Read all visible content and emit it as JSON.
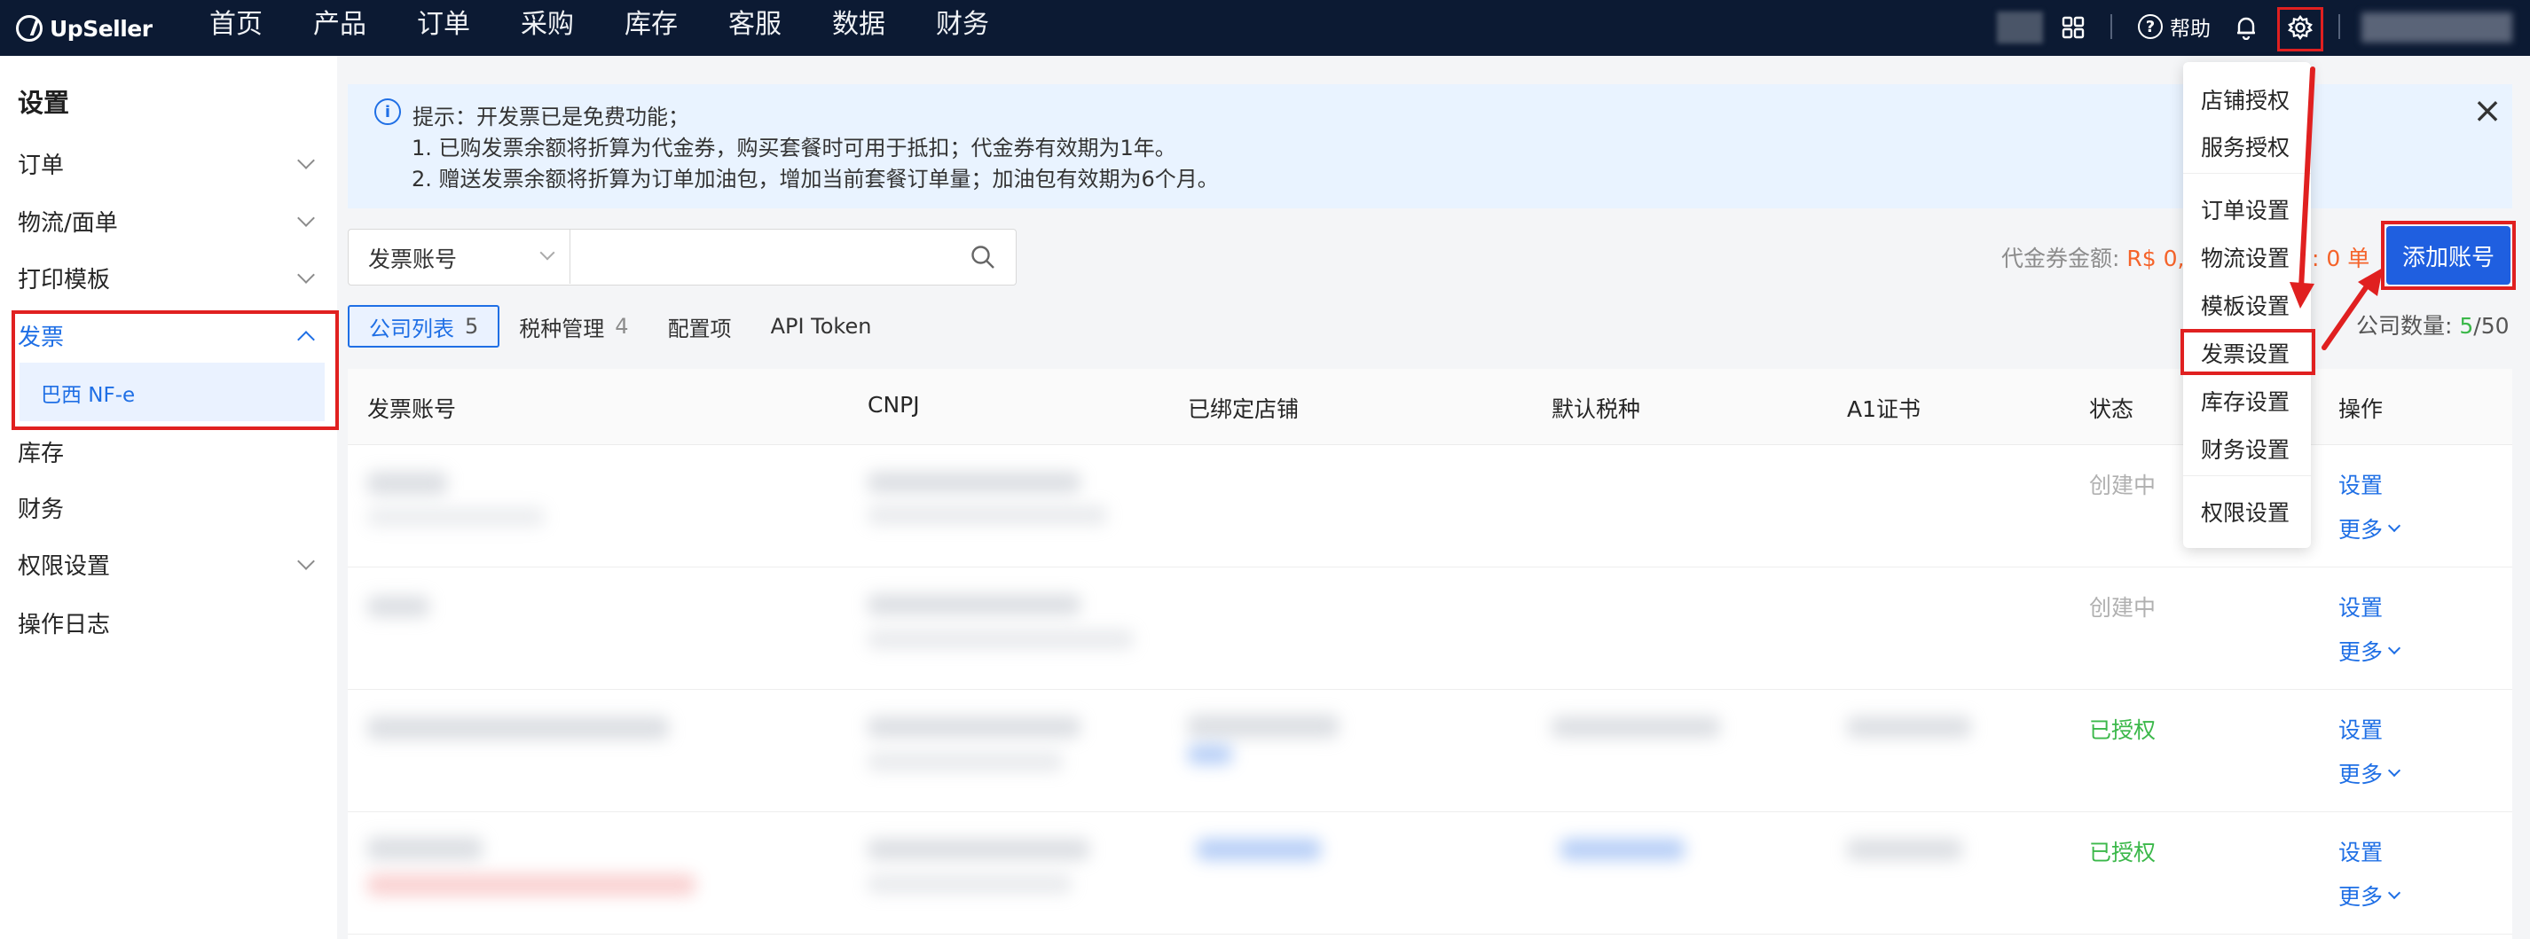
{
  "app": {
    "logo_text": "UpSeller"
  },
  "nav": {
    "items": [
      "首页",
      "产品",
      "订单",
      "采购",
      "库存",
      "客服",
      "数据",
      "财务"
    ]
  },
  "topbar": {
    "help_label": "帮助"
  },
  "sidebar": {
    "title": "设置",
    "items": [
      {
        "label": "订单"
      },
      {
        "label": "物流/面单"
      },
      {
        "label": "打印模板"
      },
      {
        "label": "发票"
      },
      {
        "label": "库存"
      },
      {
        "label": "财务"
      },
      {
        "label": "权限设置"
      },
      {
        "label": "操作日志"
      }
    ],
    "sub_item": "巴西 NF-e"
  },
  "notice": {
    "line1": "提示：开发票已是免费功能；",
    "line2": "1. 已购发票余额将折算为代金券，购买套餐时可用于抵扣；代金券有效期为1年。",
    "line3": "2. 赠送发票余额将折算为订单加油包，增加当前套餐订单量；加油包有效期为6个月。"
  },
  "search": {
    "select_value": "发票账号",
    "placeholder": ""
  },
  "voucher": {
    "label": "代金券金额: ",
    "value": "R$ 0,0",
    "tail": ": 0 单"
  },
  "add_button": "添加账号",
  "tabs": [
    {
      "label": "公司列表",
      "count": "5"
    },
    {
      "label": "税种管理",
      "count": "4"
    },
    {
      "label": "配置项",
      "count": ""
    },
    {
      "label": "API Token",
      "count": ""
    }
  ],
  "company_count": {
    "label": "公司数量: ",
    "current": "5",
    "total": "/50"
  },
  "table": {
    "headers": [
      "发票账号",
      "CNPJ",
      "已绑定店铺",
      "默认税种",
      "A1证书",
      "状态",
      "操作"
    ],
    "rows": [
      {
        "status": "创建中",
        "set": "设置",
        "more": "更多"
      },
      {
        "status": "创建中",
        "set": "设置",
        "more": "更多"
      },
      {
        "status": "已授权",
        "set": "设置",
        "more": "更多"
      },
      {
        "status": "已授权",
        "set": "设置",
        "more": "更多"
      }
    ]
  },
  "dropdown": {
    "items": [
      "店铺授权",
      "服务授权",
      "订单设置",
      "物流设置",
      "模板设置",
      "发票设置",
      "库存设置",
      "财务设置",
      "权限设置"
    ]
  },
  "colors": {
    "brand_blue": "#1f6fe5",
    "topbar": "#0c1a33",
    "highlight_red": "#e02020",
    "success": "#3bb84a",
    "warn": "#f5632a"
  },
  "icons": {
    "apps": "grid-icon",
    "help": "help-circle-icon",
    "bell": "bell-icon",
    "settings": "gear-icon",
    "search": "search-icon",
    "info": "info-icon",
    "close": "close-icon"
  }
}
